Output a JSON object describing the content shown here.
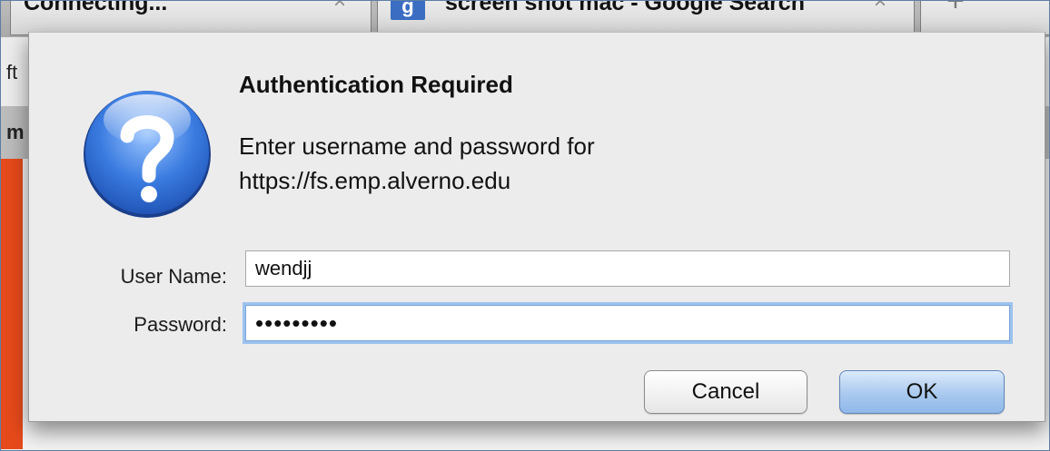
{
  "browser": {
    "tabs": [
      {
        "label": "Connecting...",
        "close_glyph": "×"
      },
      {
        "label": "screen shot mac - Google Search",
        "favicon": "g",
        "close_glyph": "×"
      }
    ],
    "new_tab_glyph": "+",
    "url_fragment": "ft",
    "bookmark_fragment": "m"
  },
  "dialog": {
    "icon": "question-mark-icon",
    "title": "Authentication Required",
    "message_line1": "Enter username and password for",
    "message_line2": "https://fs.emp.alverno.edu",
    "fields": {
      "username_label": "User Name:",
      "username_value": "wendjj",
      "password_label": "Password:",
      "password_value": "•••••••••"
    },
    "buttons": {
      "cancel_label": "Cancel",
      "ok_label": "OK"
    }
  },
  "colors": {
    "ok_button": "#a9c9ee",
    "focus_ring": "#9cc3ee",
    "icon_blue": "#2f6fd8",
    "page_accent": "#e64a1b"
  }
}
